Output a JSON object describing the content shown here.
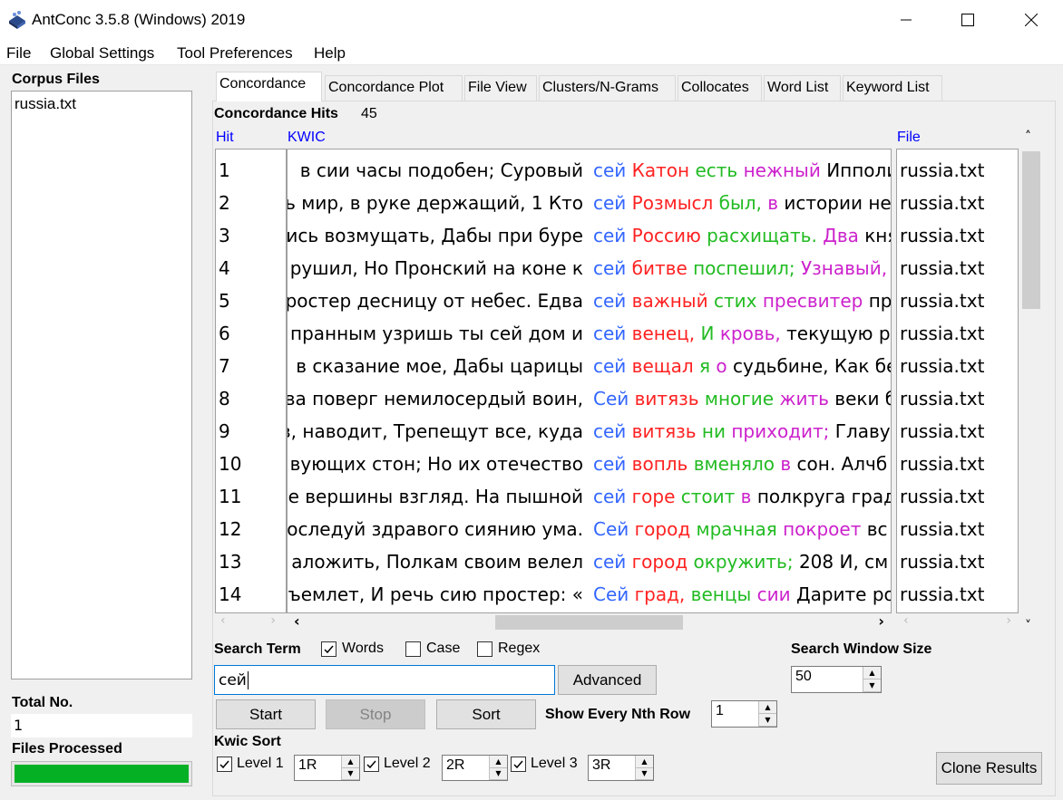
{
  "window": {
    "title": "AntConc 3.5.8 (Windows) 2019"
  },
  "menu": [
    "File",
    "Global Settings",
    "Tool Preferences",
    "Help"
  ],
  "left": {
    "corpus_files_label": "Corpus Files",
    "files": [
      "russia.txt"
    ],
    "total_label": "Total No.",
    "total_value": "1",
    "processed_label": "Files Processed",
    "progress": 1.0
  },
  "tabs": [
    "Concordance",
    "Concordance Plot",
    "File View",
    "Clusters/N-Grams",
    "Collocates",
    "Word List",
    "Keyword List"
  ],
  "concordance": {
    "hits_label": "Concordance Hits",
    "hits_value": "45",
    "col_hit": "Hit",
    "col_kwic": "KWIC",
    "col_file": "File",
    "rows": [
      {
        "n": "1",
        "left": "в сии часы подобен; Суровый ",
        "kw": "сей",
        "r1": "Катон",
        "r2": "есть",
        "r3": "нежный",
        "rest": "Ипполит",
        "file": "russia.txt"
      },
      {
        "n": "2",
        "left": "ь мир, в руке держащий,  1 Кто ",
        "kw": "сей",
        "r1": "Розмысл",
        "r2": "был,",
        "r3": "в",
        "rest": "истории не",
        "file": "russia.txt"
      },
      {
        "n": "3",
        "left": "ись возмущать, Дабы при буре ",
        "kw": "сей",
        "r1": "Россию",
        "r2": "расхищать.",
        "r3": "Два",
        "rest": "князя",
        "file": "russia.txt"
      },
      {
        "n": "4",
        "left": "рушил, Но Пронский на коне к ",
        "kw": "сей",
        "r1": "битве",
        "r2": "поспешил;",
        "r3": "Узнавый,",
        "rest": "",
        "file": "russia.txt"
      },
      {
        "n": "5",
        "left": "ростер десницу от небес. Едва ",
        "kw": "сей",
        "r1": "важный",
        "r2": "стих",
        "r3": "пресвитер",
        "rest": "про",
        "file": "russia.txt"
      },
      {
        "n": "6",
        "left": "пранным узришь ты сей дом и ",
        "kw": "сей",
        "r1": "венец,",
        "r2": "И",
        "r3": "кровь,",
        "rest": "текущую р",
        "file": "russia.txt"
      },
      {
        "n": "7",
        "left": "в сказание мое, Дабы царицы ",
        "kw": "сей",
        "r1": "вещал",
        "r2": "я",
        "r3": "о",
        "rest": "судьбине, Как бе",
        "file": "russia.txt"
      },
      {
        "n": "8",
        "left": "ва поверг немилосердый воин, ",
        "kw": "Сей",
        "r1": "витязь",
        "r2": "многие",
        "r3": "жить",
        "rest": "веки б",
        "file": "russia.txt"
      },
      {
        "n": "9",
        "left": "в, наводит, Трепещут все, куда ",
        "kw": "сей",
        "r1": "витязь",
        "r2": "ни",
        "r3": "приходит;",
        "rest": "Главу",
        "file": "russia.txt"
      },
      {
        "n": "10",
        "left": "вующих стон; Но их отечество ",
        "kw": "сей",
        "r1": "вопль",
        "r2": "вменяло",
        "r3": "в",
        "rest": "сон.  Алчб",
        "file": "russia.txt"
      },
      {
        "n": "11",
        "left": "е вершины взгляд. На пышной ",
        "kw": "сей",
        "r1": "горе",
        "r2": "стоит",
        "r3": "в",
        "rest": "полкруга град",
        "file": "russia.txt"
      },
      {
        "n": "12",
        "left": "оследуй здравого сиянию ума. ",
        "kw": "Сей",
        "r1": "город",
        "r2": "мрачная",
        "r3": "покроет",
        "rest": "вс",
        "file": "russia.txt"
      },
      {
        "n": "13",
        "left": "аложить, Полкам своим велел ",
        "kw": "сей",
        "r1": "город",
        "r2": "окружить;",
        "r3": "",
        "rest": "208 И, см",
        "file": "russia.txt"
      },
      {
        "n": "14",
        "left": "бъемлет, И речь сию простер: « ",
        "kw": "Сей",
        "r1": "град,",
        "r2": "венцы",
        "r3": "сии",
        "rest": "Дарите рос",
        "file": "russia.txt"
      }
    ]
  },
  "search": {
    "term_label": "Search Term",
    "words_label": "Words",
    "case_label": "Case",
    "regex_label": "Regex",
    "words_checked": true,
    "case_checked": false,
    "regex_checked": false,
    "value": "сей",
    "advanced_label": "Advanced",
    "window_size_label": "Search Window Size",
    "window_size_value": "50"
  },
  "controls": {
    "start_label": "Start",
    "stop_label": "Stop",
    "sort_label": "Sort",
    "nth_row_label": "Show Every Nth Row",
    "nth_row_value": "1",
    "kwic_sort_label": "Kwic Sort",
    "levels": [
      {
        "label": "Level 1",
        "value": "1R"
      },
      {
        "label": "Level 2",
        "value": "2R"
      },
      {
        "label": "Level 3",
        "value": "3R"
      }
    ],
    "clone_label": "Clone Results"
  }
}
